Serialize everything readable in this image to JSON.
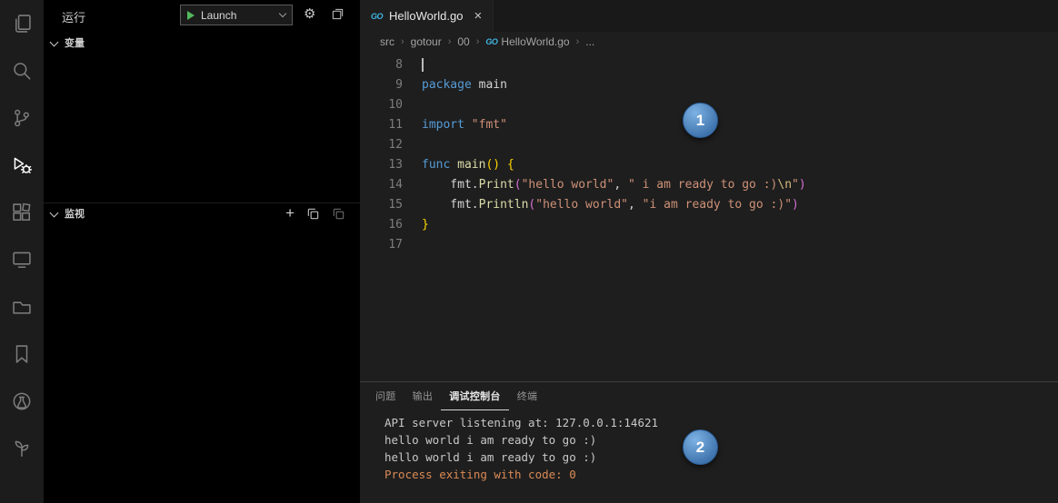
{
  "colors": {
    "keyword_blue": "#569cd6",
    "function_yellow": "#dcdcaa",
    "string_orange": "#ce9178",
    "escape_tan": "#d7ba7d",
    "plain_text": "#d4d4d4",
    "bracket_gold": "#ffd700",
    "bracket_orchid": "#d670d6",
    "badge_blue": "#4a7fb8",
    "exit_message_orange": "#db8a55",
    "go_icon_blue": "#3fb6e3"
  },
  "activity_bar": {
    "icons": [
      {
        "name": "explorer-icon",
        "active": false
      },
      {
        "name": "search-icon",
        "active": false
      },
      {
        "name": "source-control-icon",
        "active": false
      },
      {
        "name": "run-debug-icon",
        "active": true
      },
      {
        "name": "extensions-icon",
        "active": false
      },
      {
        "name": "remote-explorer-icon",
        "active": false
      },
      {
        "name": "containers-icon",
        "active": false
      },
      {
        "name": "bookmarks-icon",
        "active": false
      },
      {
        "name": "test-explorer-icon",
        "active": false
      },
      {
        "name": "outline-icon",
        "active": false
      }
    ]
  },
  "sidebar": {
    "title": "运行",
    "launch_label": "Launch",
    "sections": [
      {
        "slug": "variables",
        "label": "变量"
      },
      {
        "slug": "watch",
        "label": "监视"
      }
    ]
  },
  "editor": {
    "tab_label": "HelloWorld.go",
    "breadcrumb": [
      {
        "label": "src"
      },
      {
        "label": "gotour"
      },
      {
        "label": "00"
      },
      {
        "label": "HelloWorld.go",
        "icon": "go-file-icon"
      },
      {
        "label": "..."
      }
    ],
    "lines": [
      {
        "num": "8",
        "cursor": true,
        "tokens": []
      },
      {
        "num": "9",
        "tokens": [
          [
            "kw",
            "package"
          ],
          [
            "pl",
            " main"
          ]
        ]
      },
      {
        "num": "10",
        "tokens": []
      },
      {
        "num": "11",
        "tokens": [
          [
            "kw",
            "import"
          ],
          [
            "pl",
            " "
          ],
          [
            "str",
            "\"fmt\""
          ]
        ]
      },
      {
        "num": "12",
        "tokens": []
      },
      {
        "num": "13",
        "tokens": [
          [
            "kw",
            "func"
          ],
          [
            "pl",
            " "
          ],
          [
            "fn",
            "main"
          ],
          [
            "b0",
            "()"
          ],
          [
            "pl",
            " "
          ],
          [
            "b0",
            "{"
          ]
        ]
      },
      {
        "num": "14",
        "tokens": [
          [
            "pl",
            "    fmt."
          ],
          [
            "fn",
            "Print"
          ],
          [
            "b1",
            "("
          ],
          [
            "str",
            "\"hello world\""
          ],
          [
            "pl",
            ", "
          ],
          [
            "str",
            "\" i am ready to go :)"
          ],
          [
            "esc",
            "\\n"
          ],
          [
            "str",
            "\""
          ],
          [
            "b1",
            ")"
          ]
        ]
      },
      {
        "num": "15",
        "tokens": [
          [
            "pl",
            "    fmt."
          ],
          [
            "fn",
            "Println"
          ],
          [
            "b1",
            "("
          ],
          [
            "str",
            "\"hello world\""
          ],
          [
            "pl",
            ", "
          ],
          [
            "str",
            "\"i am ready to go :)\""
          ],
          [
            "b1",
            ")"
          ]
        ]
      },
      {
        "num": "16",
        "tokens": [
          [
            "b0",
            "}"
          ]
        ]
      },
      {
        "num": "17",
        "tokens": []
      }
    ]
  },
  "panel": {
    "tabs": [
      {
        "slug": "problems",
        "label": "问题",
        "active": false
      },
      {
        "slug": "output",
        "label": "输出",
        "active": false
      },
      {
        "slug": "debug-console",
        "label": "调试控制台",
        "active": true
      },
      {
        "slug": "terminal",
        "label": "终端",
        "active": false
      }
    ],
    "console_lines": [
      {
        "text": "API server listening at: 127.0.0.1:14621",
        "color": "#c8c8c8"
      },
      {
        "text": "hello world i am ready to go :)",
        "color": "#c8c8c8"
      },
      {
        "text": "hello world i am ready to go :)",
        "color": "#c8c8c8"
      },
      {
        "text": "Process exiting with code: 0",
        "color": "#db8a55"
      }
    ]
  },
  "annotations": [
    {
      "label": "1"
    },
    {
      "label": "2"
    }
  ]
}
